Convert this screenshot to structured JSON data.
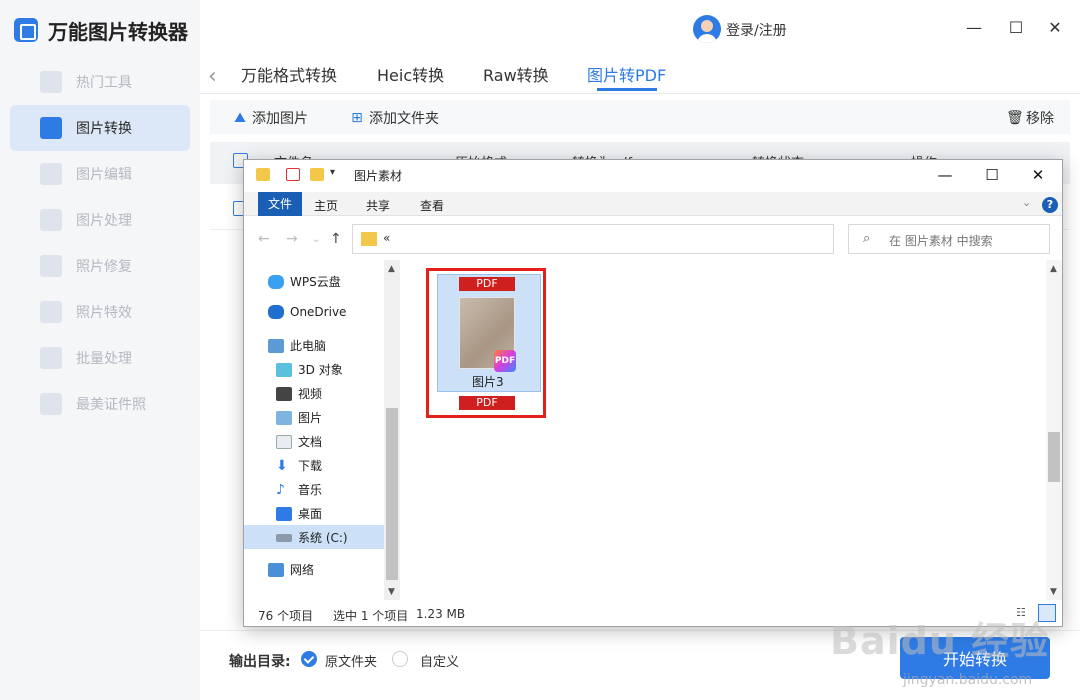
{
  "app": {
    "title": "万能图片转换器",
    "login": "登录/注册"
  },
  "sidebar": {
    "items": [
      {
        "label": "热门工具",
        "active": false
      },
      {
        "label": "图片转换",
        "active": true
      },
      {
        "label": "图片编辑",
        "active": false
      },
      {
        "label": "图片处理",
        "active": false
      },
      {
        "label": "照片修复",
        "active": false
      },
      {
        "label": "照片特效",
        "active": false
      },
      {
        "label": "批量处理",
        "active": false
      },
      {
        "label": "最美证件照",
        "active": false
      }
    ]
  },
  "tabs": [
    {
      "label": "万能格式转换"
    },
    {
      "label": "Heic转换"
    },
    {
      "label": "Raw转换"
    },
    {
      "label": "图片转PDF",
      "active": true
    }
  ],
  "toolbar": {
    "add_image": "添加图片",
    "add_folder": "添加文件夹",
    "remove": "移除"
  },
  "table": {
    "headers": [
      "文件名",
      "原始格式",
      "转换为pdf",
      "转换状态",
      "操作"
    ]
  },
  "output": {
    "label": "输出目录:",
    "option_source": "原文件夹",
    "option_custom": "自定义",
    "selected": "原文件夹"
  },
  "start_button": "开始转换",
  "dialog": {
    "title": "图片素材",
    "ribbon_tabs": [
      "文件",
      "主页",
      "共享",
      "查看"
    ],
    "address": "«",
    "search_placeholder": "在 图片素材 中搜索",
    "nav_items": [
      {
        "label": "WPS云盘",
        "icon": "cloud-icon"
      },
      {
        "label": "OneDrive",
        "icon": "onedrive-icon"
      },
      {
        "label": "此电脑",
        "icon": "computer-icon"
      },
      {
        "label": "3D 对象",
        "icon": "3d-objects-icon"
      },
      {
        "label": "视频",
        "icon": "video-icon"
      },
      {
        "label": "图片",
        "icon": "pictures-icon"
      },
      {
        "label": "文档",
        "icon": "documents-icon"
      },
      {
        "label": "下载",
        "icon": "download-icon"
      },
      {
        "label": "音乐",
        "icon": "music-icon"
      },
      {
        "label": "桌面",
        "icon": "desktop-icon"
      },
      {
        "label": "系统 (C:)",
        "icon": "drive-icon",
        "selected": true
      },
      {
        "label": "网络",
        "icon": "network-icon"
      }
    ],
    "file": {
      "name": "图片3",
      "badge_top": "PDF",
      "badge_bottom": "PDF",
      "thumb_badge": "PDF"
    },
    "status": {
      "count": "76 个项目",
      "selected": "选中 1 个项目",
      "size": "1.23 MB"
    }
  },
  "watermark": {
    "logo": "Baidu 经验",
    "url": "jingyan.baidu.com"
  },
  "colors": {
    "accent": "#2f7be5",
    "highlight_box": "#e3201b",
    "pdf_red": "#d01f1f"
  }
}
